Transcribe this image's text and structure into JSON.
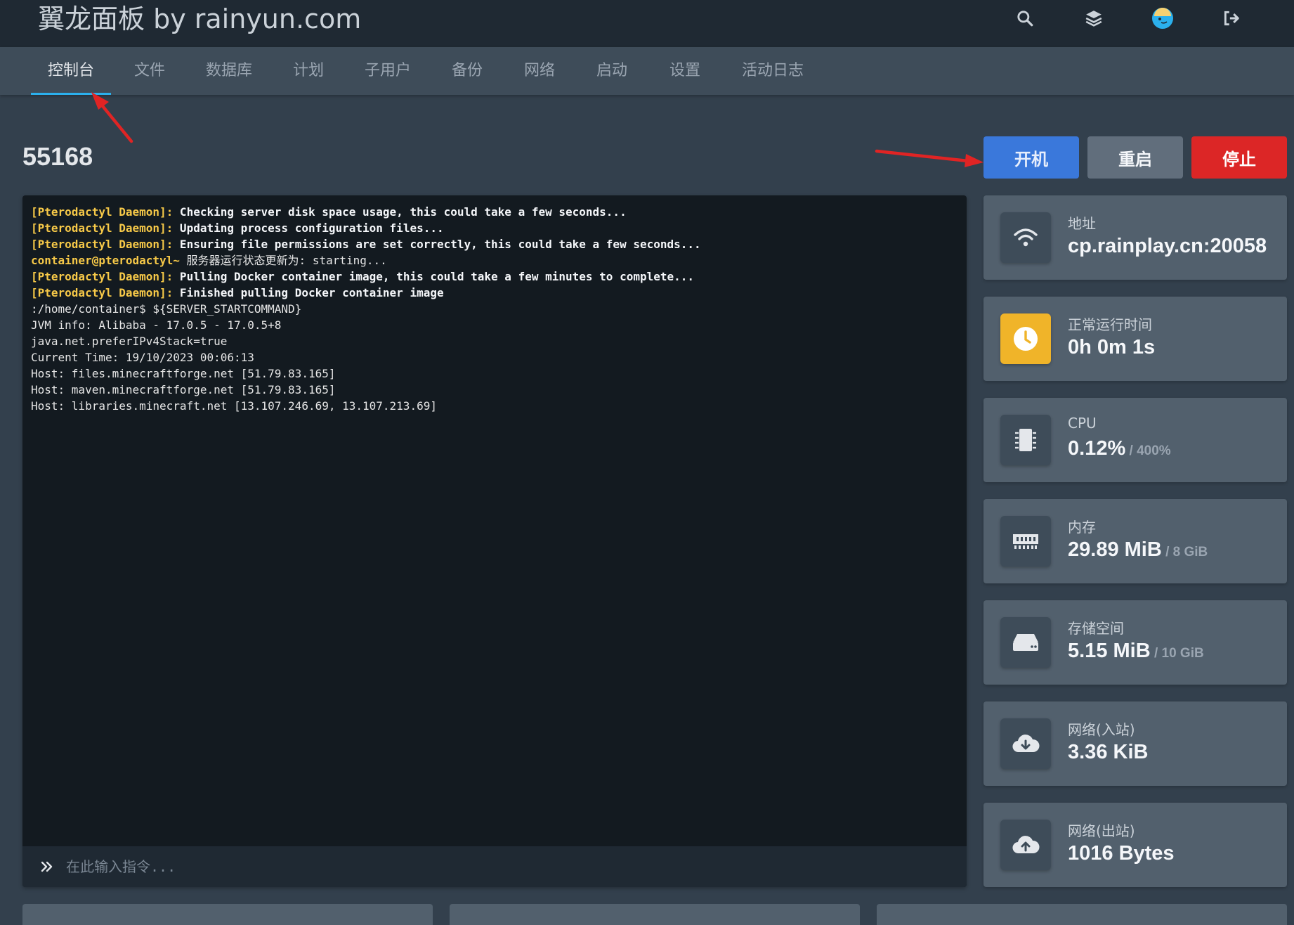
{
  "header": {
    "brand": "翼龙面板 by rainyun.com",
    "icons": [
      "search-icon",
      "layers-icon",
      "avatar",
      "logout-icon"
    ]
  },
  "nav": {
    "tabs": [
      {
        "label": "控制台",
        "active": true
      },
      {
        "label": "文件"
      },
      {
        "label": "数据库"
      },
      {
        "label": "计划"
      },
      {
        "label": "子用户"
      },
      {
        "label": "备份"
      },
      {
        "label": "网络"
      },
      {
        "label": "启动"
      },
      {
        "label": "设置"
      },
      {
        "label": "活动日志"
      }
    ]
  },
  "server": {
    "name": "55168"
  },
  "power": {
    "start": "开机",
    "restart": "重启",
    "stop": "停止"
  },
  "console": {
    "lines": [
      {
        "prefix": "[Pterodactyl Daemon]:",
        "text": " Checking server disk space usage, this could take a few seconds...",
        "style": "bold"
      },
      {
        "prefix": "[Pterodactyl Daemon]:",
        "text": " Updating process configuration files...",
        "style": "bold"
      },
      {
        "prefix": "[Pterodactyl Daemon]:",
        "text": " Ensuring file permissions are set correctly, this could take a few seconds...",
        "style": "bold"
      },
      {
        "prefix": "container@pterodactyl~",
        "text": " 服务器运行状态更新为: starting...",
        "style": "plain"
      },
      {
        "prefix": "[Pterodactyl Daemon]:",
        "text": " Pulling Docker container image, this could take a few minutes to complete...",
        "style": "bold"
      },
      {
        "prefix": "[Pterodactyl Daemon]:",
        "text": " Finished pulling Docker container image",
        "style": "bold"
      },
      {
        "prefix": "",
        "text": ":/home/container$ ${SERVER_STARTCOMMAND}",
        "style": "plain"
      },
      {
        "prefix": "",
        "text": "JVM info: Alibaba - 17.0.5 - 17.0.5+8",
        "style": "plain"
      },
      {
        "prefix": "",
        "text": "java.net.preferIPv4Stack=true",
        "style": "plain"
      },
      {
        "prefix": "",
        "text": "Current Time: 19/10/2023 00:06:13",
        "style": "plain"
      },
      {
        "prefix": "",
        "text": "Host: files.minecraftforge.net [51.79.83.165]",
        "style": "plain"
      },
      {
        "prefix": "",
        "text": "Host: maven.minecraftforge.net [51.79.83.165]",
        "style": "plain"
      },
      {
        "prefix": "",
        "text": "Host: libraries.minecraft.net [13.107.246.69, 13.107.213.69]",
        "style": "plain"
      }
    ],
    "input_placeholder": "在此输入指令..."
  },
  "stats": [
    {
      "label": "地址",
      "value": "cp.rainplay.cn:20058",
      "limit": "",
      "icon": "wifi-icon"
    },
    {
      "label": "正常运行时间",
      "value": "0h 0m 1s",
      "limit": "",
      "icon": "clock-icon",
      "accent": "#f0b429"
    },
    {
      "label": "CPU",
      "value": "0.12%",
      "limit": " / 400%",
      "icon": "cpu-icon"
    },
    {
      "label": "内存",
      "value": "29.89 MiB",
      "limit": " / 8 GiB",
      "icon": "memory-icon"
    },
    {
      "label": "存储空间",
      "value": "5.15 MiB",
      "limit": " / 10 GiB",
      "icon": "hdd-icon"
    },
    {
      "label": "网络(入站)",
      "value": "3.36 KiB",
      "limit": "",
      "icon": "cloud-download-icon"
    },
    {
      "label": "网络(出站)",
      "value": "1016 Bytes",
      "limit": "",
      "icon": "cloud-upload-icon"
    }
  ],
  "colors": {
    "accent": "#2bb0ed",
    "start": "#3a78db",
    "restart": "#616e7c",
    "stop": "#dc2626",
    "console_prefix": "#f7c948"
  }
}
